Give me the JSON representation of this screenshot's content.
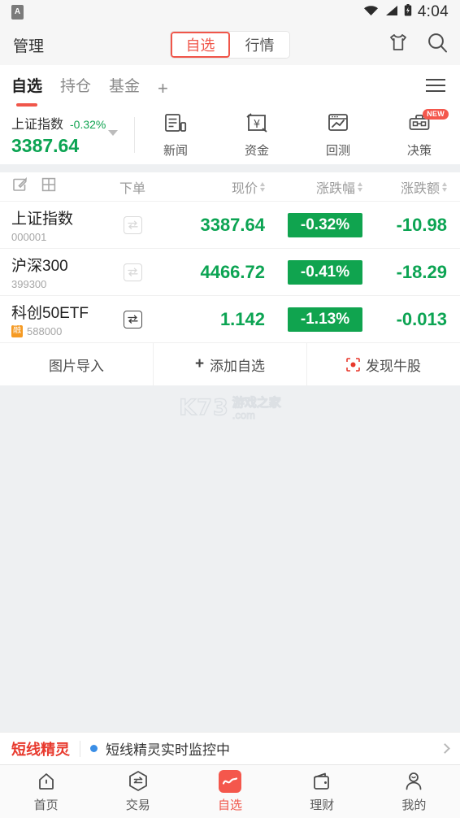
{
  "statusbar": {
    "app_icon": "app-notification-icon",
    "time": "4:04",
    "icons": [
      "wifi-icon",
      "signal-icon",
      "battery-icon"
    ]
  },
  "header": {
    "manage_label": "管理",
    "segments": [
      {
        "label": "自选",
        "active": true
      },
      {
        "label": "行情",
        "active": false
      }
    ],
    "icons": [
      {
        "name": "tshirt-skin-icon"
      },
      {
        "name": "search-icon"
      }
    ]
  },
  "tabs": {
    "items": [
      {
        "label": "自选",
        "active": true
      },
      {
        "label": "持仓",
        "active": false
      },
      {
        "label": "基金",
        "active": false
      }
    ],
    "add_label": "+",
    "menu_icon": "hamburger-menu-icon"
  },
  "index_card": {
    "name": "上证指数",
    "change_pct": "-0.32%",
    "value": "3387.64",
    "dropdown_icon": "chevron-down-icon",
    "green": "#0ca453"
  },
  "quick_actions": [
    {
      "label": "新闻",
      "icon": "news-document-icon",
      "badge": ""
    },
    {
      "label": "资金",
      "icon": "yen-funds-icon",
      "badge": ""
    },
    {
      "label": "回测",
      "icon": "chart-backtest-icon",
      "badge": ""
    },
    {
      "label": "决策",
      "icon": "briefcase-decision-icon",
      "badge": "NEW"
    }
  ],
  "table": {
    "header_icons": [
      {
        "name": "edit-icon"
      },
      {
        "name": "grid-view-icon"
      }
    ],
    "columns": [
      {
        "label": "下单",
        "sortable": false
      },
      {
        "label": "现价",
        "sortable": true
      },
      {
        "label": "涨跌幅",
        "sortable": true
      },
      {
        "label": "涨跌额",
        "sortable": true
      }
    ],
    "rows": [
      {
        "name": "上证指数",
        "code": "000001",
        "margin_tag": "",
        "trade_enabled": false,
        "price": "3387.64",
        "change_pct": "-0.32%",
        "change_amt": "-10.98"
      },
      {
        "name": "沪深300",
        "code": "399300",
        "margin_tag": "",
        "trade_enabled": false,
        "price": "4466.72",
        "change_pct": "-0.41%",
        "change_amt": "-18.29"
      },
      {
        "name": "科创50ETF",
        "code": "588000",
        "margin_tag": "融",
        "trade_enabled": true,
        "price": "1.142",
        "change_pct": "-1.13%",
        "change_amt": "-0.013"
      }
    ]
  },
  "footer_buttons": [
    {
      "label": "图片导入",
      "icon": ""
    },
    {
      "label": "添加自选",
      "icon": "plus-icon"
    },
    {
      "label": "发现牛股",
      "icon": "scan-discover-icon"
    }
  ],
  "watermark": {
    "brand": "K73",
    "cn": "游戏之家",
    "domain": ".com"
  },
  "notice": {
    "tag": "短线精灵",
    "text": "短线精灵实时监控中",
    "dot_color": "#3a8ee6",
    "chevron": "chevron-right-icon"
  },
  "bottom_nav": [
    {
      "label": "首页",
      "icon": "home-icon",
      "active": false
    },
    {
      "label": "交易",
      "icon": "exchange-hexagon-icon",
      "active": false
    },
    {
      "label": "自选",
      "icon": "watchlist-chart-icon",
      "active": true
    },
    {
      "label": "理财",
      "icon": "wallet-icon",
      "active": false
    },
    {
      "label": "我的",
      "icon": "profile-person-icon",
      "active": false
    }
  ],
  "colors": {
    "accent": "#f0564a",
    "down_green": "#0ca453",
    "margin_orange": "#f59a23"
  }
}
